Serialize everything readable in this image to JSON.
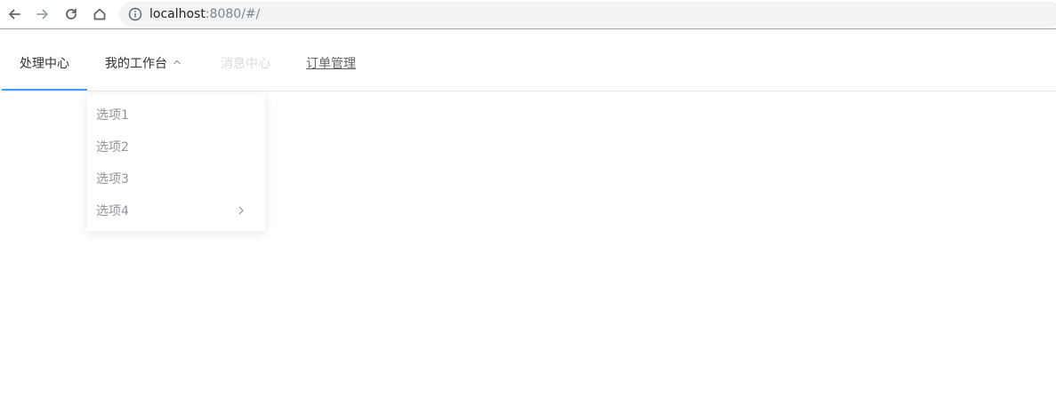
{
  "browser": {
    "url_host": "localhost",
    "url_path": ":8080/#/",
    "icons": {
      "back": "arrow-left-icon",
      "forward": "arrow-right-icon",
      "reload": "reload-icon",
      "home": "home-icon",
      "info": "info-icon"
    }
  },
  "menu": {
    "items": [
      {
        "label": "处理中心",
        "state": "active"
      },
      {
        "label": "我的工作台",
        "state": "open"
      },
      {
        "label": "消息中心",
        "state": "disabled"
      },
      {
        "label": "订单管理",
        "state": "link"
      }
    ],
    "accent_color": "#409eff"
  },
  "submenu": {
    "items": [
      {
        "label": "选项1"
      },
      {
        "label": "选项2"
      },
      {
        "label": "选项3"
      },
      {
        "label": "选项4",
        "has_children": true
      }
    ]
  }
}
